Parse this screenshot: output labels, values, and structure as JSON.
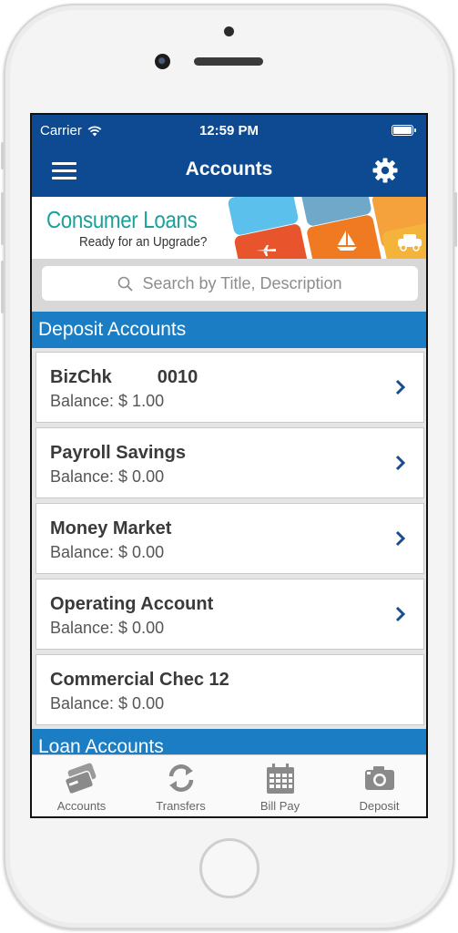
{
  "status_bar": {
    "carrier": "Carrier",
    "time": "12:59 PM"
  },
  "header": {
    "title": "Accounts"
  },
  "banner": {
    "headline": "Consumer Loans",
    "subline": "Ready for an Upgrade?"
  },
  "search": {
    "placeholder": "Search by Title, Description"
  },
  "sections": {
    "deposit": "Deposit Accounts",
    "loan": "Loan Accounts"
  },
  "accounts": [
    {
      "name": "BizChk         0010",
      "balance": "Balance: $ 1.00"
    },
    {
      "name": "Payroll Savings",
      "balance": "Balance: $ 0.00"
    },
    {
      "name": "Money Market",
      "balance": "Balance: $ 0.00"
    },
    {
      "name": "Operating Account",
      "balance": "Balance: $ 0.00"
    },
    {
      "name": "Commercial Chec 12",
      "balance": "Balance: $ 0.00"
    }
  ],
  "tabs": [
    {
      "label": "Accounts",
      "icon": "cards-icon"
    },
    {
      "label": "Transfers",
      "icon": "refresh-icon"
    },
    {
      "label": "Bill Pay",
      "icon": "calendar-icon"
    },
    {
      "label": "Deposit",
      "icon": "camera-icon"
    }
  ],
  "colors": {
    "nav": "#0d4a91",
    "section": "#1b7ec4",
    "banner_text": "#1aa19e",
    "chevron": "#1a4d8f"
  }
}
